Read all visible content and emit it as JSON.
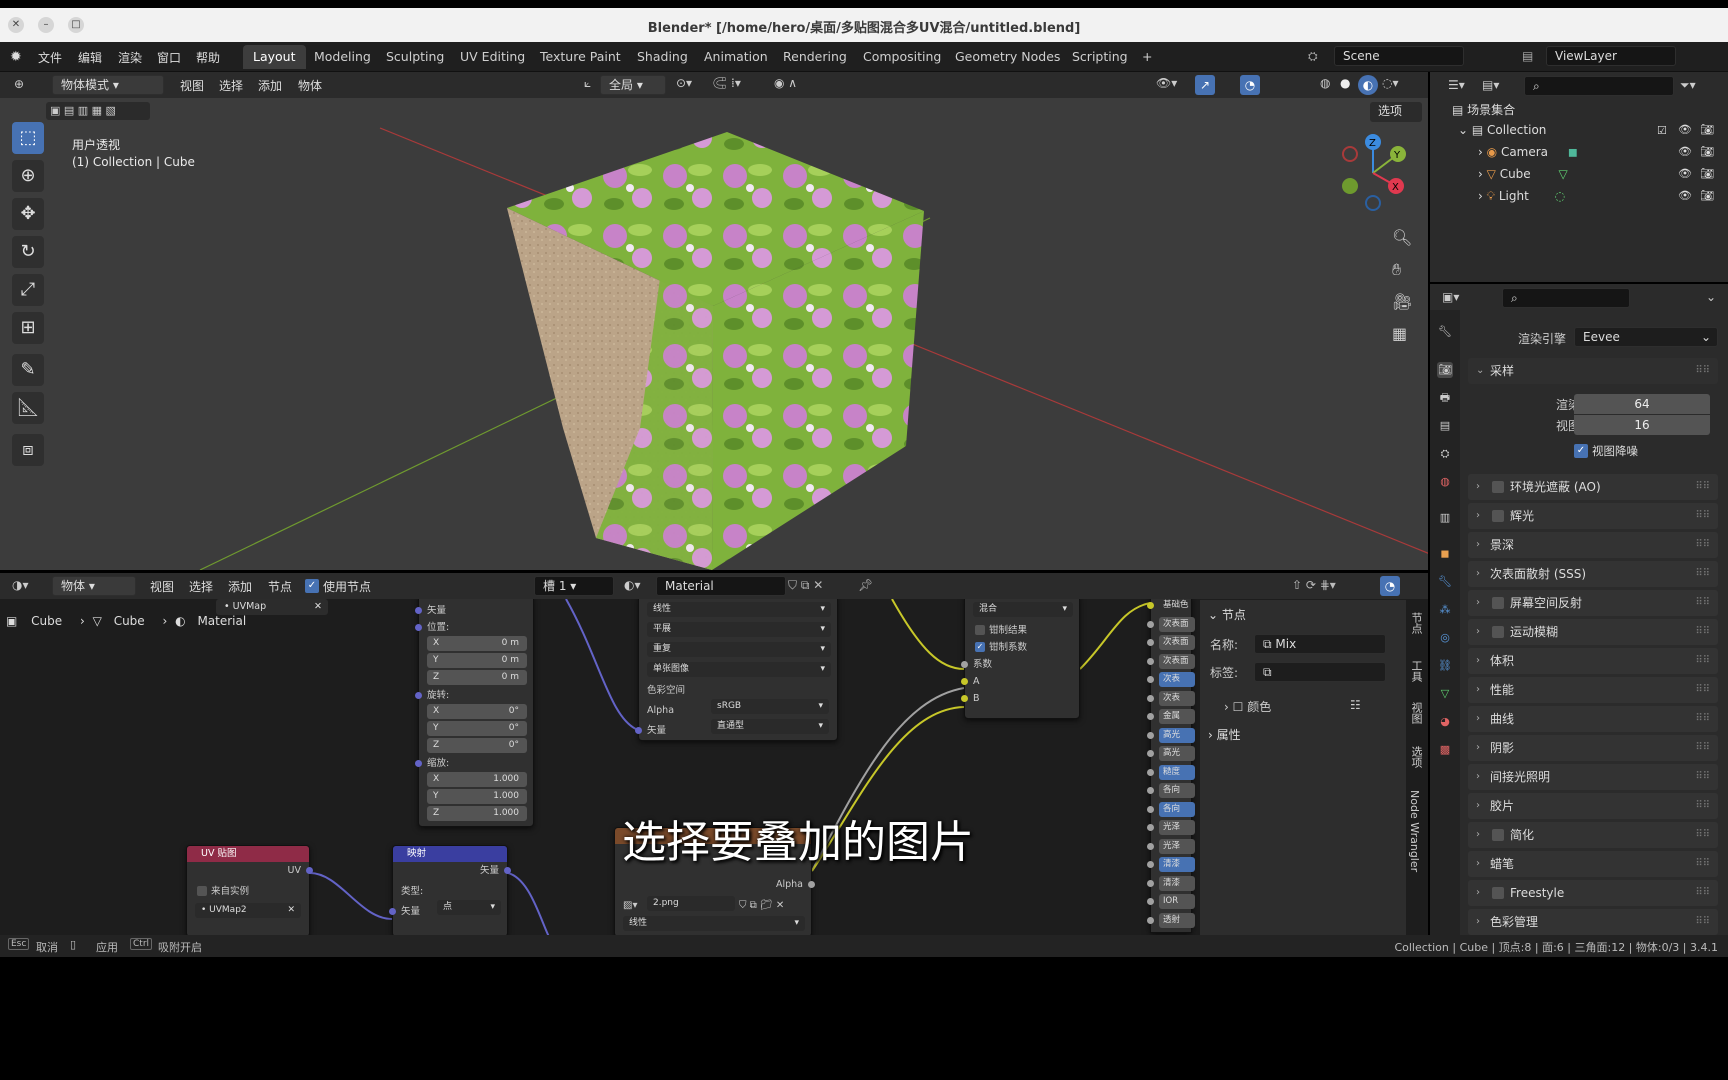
{
  "window": {
    "title": "Blender* [/home/hero/桌面/多贴图混合多UV混合/untitled.blend]",
    "close": "✕",
    "minimize": "–",
    "maximize": "□"
  },
  "menu": {
    "items": [
      "文件",
      "编辑",
      "渲染",
      "窗口",
      "帮助"
    ]
  },
  "workspaces": [
    "Layout",
    "Modeling",
    "Sculpting",
    "UV Editing",
    "Texture Paint",
    "Shading",
    "Animation",
    "Rendering",
    "Compositing",
    "Geometry Nodes",
    "Scripting"
  ],
  "workspaces_add": "+",
  "active_workspace": "Layout",
  "scene": {
    "name": "Scene",
    "view_layer": "ViewLayer"
  },
  "viewport": {
    "mode": "物体模式",
    "menus": [
      "视图",
      "选择",
      "添加",
      "物体"
    ],
    "transform_orientation": "全局",
    "options": "选项",
    "view_name": "用户透视",
    "collection_info": "(1) Collection | Cube",
    "gizmo_axes": {
      "x": "X",
      "y": "Y",
      "z": "Z"
    }
  },
  "tools": [
    "select-box-tool",
    "cursor-tool",
    "move-tool",
    "rotate-tool",
    "scale-tool",
    "transform-tool",
    "annotate-tool",
    "measure-tool",
    "add-cube-tool"
  ],
  "node_editor": {
    "mode": "物体",
    "menus": [
      "视图",
      "选择",
      "添加",
      "节点"
    ],
    "use_nodes": "使用节点",
    "slot": "槽 1",
    "material": "Material",
    "breadcrumb": [
      "Cube",
      "Cube",
      "Material"
    ],
    "uvmap_popup": "UVMap",
    "tabs": [
      "节点",
      "工具",
      "视图",
      "选项",
      "Node Wrangler"
    ]
  },
  "nodes": {
    "mapping_top": {
      "vector_in": "矢量",
      "location": "位置:",
      "loc": [
        "X",
        "0 m",
        "Y",
        "0 m",
        "Z",
        "0 m"
      ],
      "rotation": "旋转:",
      "rot": [
        "X",
        "0°",
        "Y",
        "0°",
        "Z",
        "0°"
      ],
      "scale": "缩放:",
      "scl": [
        "X",
        "1.000",
        "Y",
        "1.000",
        "Z",
        "1.000"
      ]
    },
    "image_top": {
      "interp": "线性",
      "proj": "平展",
      "ext": "重复",
      "src": "单张图像",
      "colorspace_label": "色彩空间",
      "colorspace": "sRGB",
      "alpha_label": "Alpha",
      "alpha": "直通型",
      "vector": "矢量"
    },
    "mix": {
      "blend": "混合",
      "clamp_result": "钳制结果",
      "clamp_factor": "钳制系数",
      "factor": "系数",
      "a": "A",
      "b": "B"
    },
    "bsdf_labels": [
      "基础色",
      "次表面",
      "次表面",
      "次表面",
      "次表",
      "次表",
      "金属",
      "高光",
      "高光",
      "糙度",
      "各向",
      "各向",
      "光泽",
      "光泽",
      "清漆",
      "清漆",
      "IOR",
      "透射"
    ],
    "uv": {
      "title": "UV 贴图",
      "output": "UV",
      "from_instance": "来自实例",
      "map": "UVMap2"
    },
    "mapping": {
      "title": "映射",
      "output": "矢量",
      "type_label": "类型:",
      "type": "点",
      "vector": "矢量"
    },
    "image2": {
      "alpha": "Alpha",
      "file": "2.png",
      "interp": "线性"
    }
  },
  "node_sidebar": {
    "section": "节点",
    "name_label": "名称:",
    "name": "Mix",
    "label_label": "标签:",
    "color": "颜色",
    "properties": "属性"
  },
  "outliner": {
    "root": "场景集合",
    "collection": "Collection",
    "items": [
      "Camera",
      "Cube",
      "Light"
    ]
  },
  "properties": {
    "render_engine_label": "渲染引擎",
    "render_engine": "Eevee",
    "sampling": "采样",
    "render_label": "渲染",
    "render_value": "64",
    "viewport_label": "视图",
    "viewport_value": "16",
    "viewport_denoise": "视图降噪",
    "panels": [
      "环境光遮蔽 (AO)",
      "辉光",
      "景深",
      "次表面散射 (SSS)",
      "屏幕空间反射",
      "运动模糊",
      "体积",
      "性能",
      "曲线",
      "阴影",
      "间接光照明",
      "胶片",
      "简化",
      "蜡笔",
      "Freestyle",
      "色彩管理"
    ]
  },
  "statusbar": {
    "items": [
      "Esc",
      "取消",
      "应用",
      "Ctrl",
      "吸附开启"
    ],
    "stats": "Collection | Cube | 顶点:8 | 面:6 | 三角面:12 | 物体:0/3 | 3.4.1"
  },
  "subtitle": "选择要叠加的图片",
  "colors": {
    "accent": "#4772b3",
    "uv_header": "#8f2b47",
    "mapping_header": "#3a3ea0",
    "image_header": "#7a4a2a",
    "socket_vector": "#6363c7",
    "socket_color": "#c7c729",
    "socket_gray": "#a1a1a1"
  }
}
